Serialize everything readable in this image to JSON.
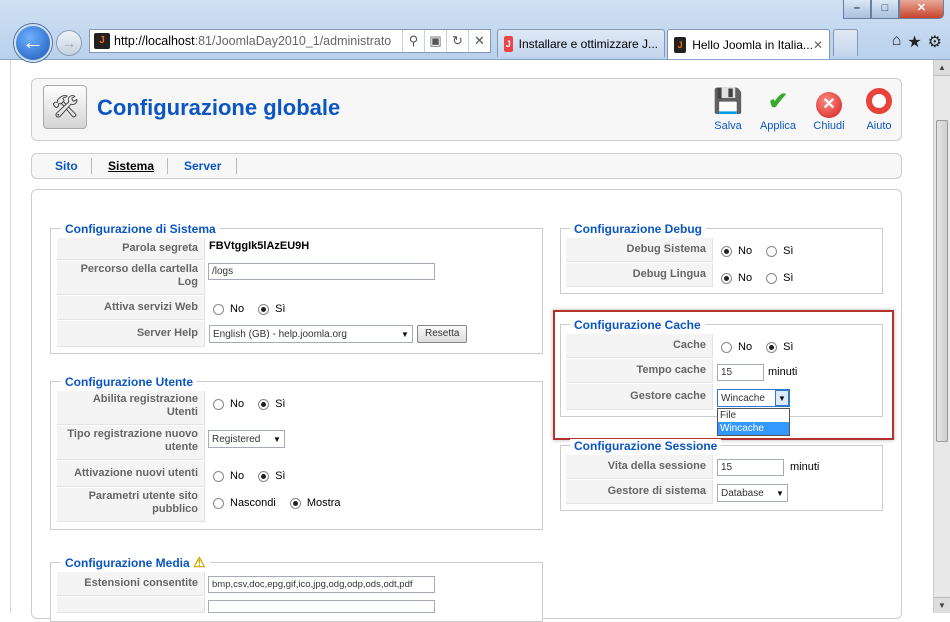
{
  "browser": {
    "url_host": "http://localhost",
    "url_rest": ":81/JoomlaDay2010_1/administrato",
    "tabs": [
      {
        "label": "Installare e ottimizzare J..."
      },
      {
        "label": "Hello Joomla in Italia..."
      }
    ]
  },
  "header": {
    "title": "Configurazione globale",
    "toolbar": {
      "save": "Salva",
      "apply": "Applica",
      "close": "Chiudi",
      "help": "Aiuto"
    }
  },
  "subnav": {
    "tabs": [
      "Sito",
      "Sistema",
      "Server"
    ]
  },
  "system": {
    "legend": "Configurazione di Sistema",
    "secret_label": "Parola segreta",
    "secret_value": "FBVtggIk5lAzEU9H",
    "log_label": "Percorso della cartella Log",
    "log_value": "/logs",
    "webservices_label": "Attiva servizi Web",
    "help_label": "Server Help",
    "help_value": "English (GB) - help.joomla.org",
    "reset_label": "Resetta"
  },
  "user": {
    "legend": "Configurazione Utente",
    "reg_label": "Abilita registrazione Utenti",
    "type_label": "Tipo registrazione nuovo utente",
    "type_value": "Registered",
    "activation_label": "Attivazione nuovi utenti",
    "params_label": "Parametri utente sito pubblico",
    "hide": "Nascondi",
    "show": "Mostra"
  },
  "media": {
    "legend": "Configurazione Media",
    "ext_label": "Estensioni consentite",
    "ext_value": "bmp,csv,doc,epg,gif,ico,jpg,odg,odp,ods,odt,pdf"
  },
  "debug": {
    "legend": "Configurazione Debug",
    "system_label": "Debug Sistema",
    "language_label": "Debug Lingua"
  },
  "cache": {
    "legend": "Configurazione Cache",
    "cache_label": "Cache",
    "time_label": "Tempo cache",
    "time_value": "15",
    "time_unit": "minuti",
    "handler_label": "Gestore cache",
    "handler_value": "Wincache",
    "handler_options": [
      "File",
      "Wincache"
    ]
  },
  "session": {
    "legend": "Configurazione Sessione",
    "life_label": "Vita della sessione",
    "life_value": "15",
    "life_unit": "minuti",
    "handler_label": "Gestore di sistema",
    "handler_value": "Database"
  },
  "common": {
    "no": "No",
    "yes": "Sì"
  }
}
